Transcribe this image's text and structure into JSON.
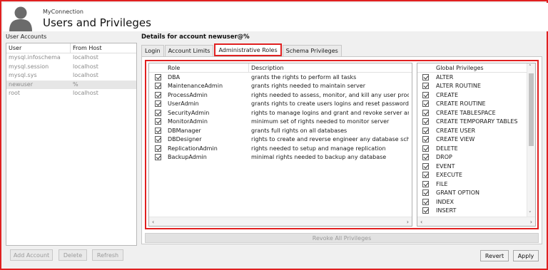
{
  "header": {
    "connection": "MyConnection",
    "title": "Users and Privileges"
  },
  "accounts": {
    "label": "User Accounts",
    "columns": [
      "User",
      "From Host"
    ],
    "rows": [
      {
        "user": "mysql.infoschema",
        "host": "localhost"
      },
      {
        "user": "mysql.session",
        "host": "localhost"
      },
      {
        "user": "mysql.sys",
        "host": "localhost"
      },
      {
        "user": "newuser",
        "host": "%"
      },
      {
        "user": "root",
        "host": "localhost"
      }
    ],
    "selected_user": "newuser"
  },
  "buttons": {
    "add": "Add Account",
    "delete": "Delete",
    "refresh": "Refresh",
    "revert": "Revert",
    "apply": "Apply",
    "revoke": "Revoke All Privileges"
  },
  "details": {
    "title": "Details for account newuser@%",
    "tabs": [
      "Login",
      "Account Limits",
      "Administrative Roles",
      "Schema Privileges"
    ],
    "active_tab": "Administrative Roles"
  },
  "roles": {
    "columns": [
      "Role",
      "Description"
    ],
    "rows": [
      {
        "role": "DBA",
        "desc": "grants the rights to perform all tasks",
        "checked": true
      },
      {
        "role": "MaintenanceAdmin",
        "desc": "grants rights needed to maintain server",
        "checked": true
      },
      {
        "role": "ProcessAdmin",
        "desc": "rights needed to assess, monitor, and kill any user proce...",
        "checked": true
      },
      {
        "role": "UserAdmin",
        "desc": "grants rights to create users logins and reset passwords",
        "checked": true
      },
      {
        "role": "SecurityAdmin",
        "desc": "rights to manage logins and grant and revoke server an...",
        "checked": true
      },
      {
        "role": "MonitorAdmin",
        "desc": "minimum set of rights needed to monitor server",
        "checked": true
      },
      {
        "role": "DBManager",
        "desc": "grants full rights on all databases",
        "checked": true
      },
      {
        "role": "DBDesigner",
        "desc": "rights to create and reverse engineer any database sche...",
        "checked": true
      },
      {
        "role": "ReplicationAdmin",
        "desc": "rights needed to setup and manage replication",
        "checked": true
      },
      {
        "role": "BackupAdmin",
        "desc": "minimal rights needed to backup any database",
        "checked": true
      }
    ]
  },
  "global_privileges": {
    "header": "Global Privileges",
    "items": [
      "ALTER",
      "ALTER ROUTINE",
      "CREATE",
      "CREATE ROUTINE",
      "CREATE TABLESPACE",
      "CREATE TEMPORARY TABLES",
      "CREATE USER",
      "CREATE VIEW",
      "DELETE",
      "DROP",
      "EVENT",
      "EXECUTE",
      "FILE",
      "GRANT OPTION",
      "INDEX",
      "INSERT"
    ]
  }
}
